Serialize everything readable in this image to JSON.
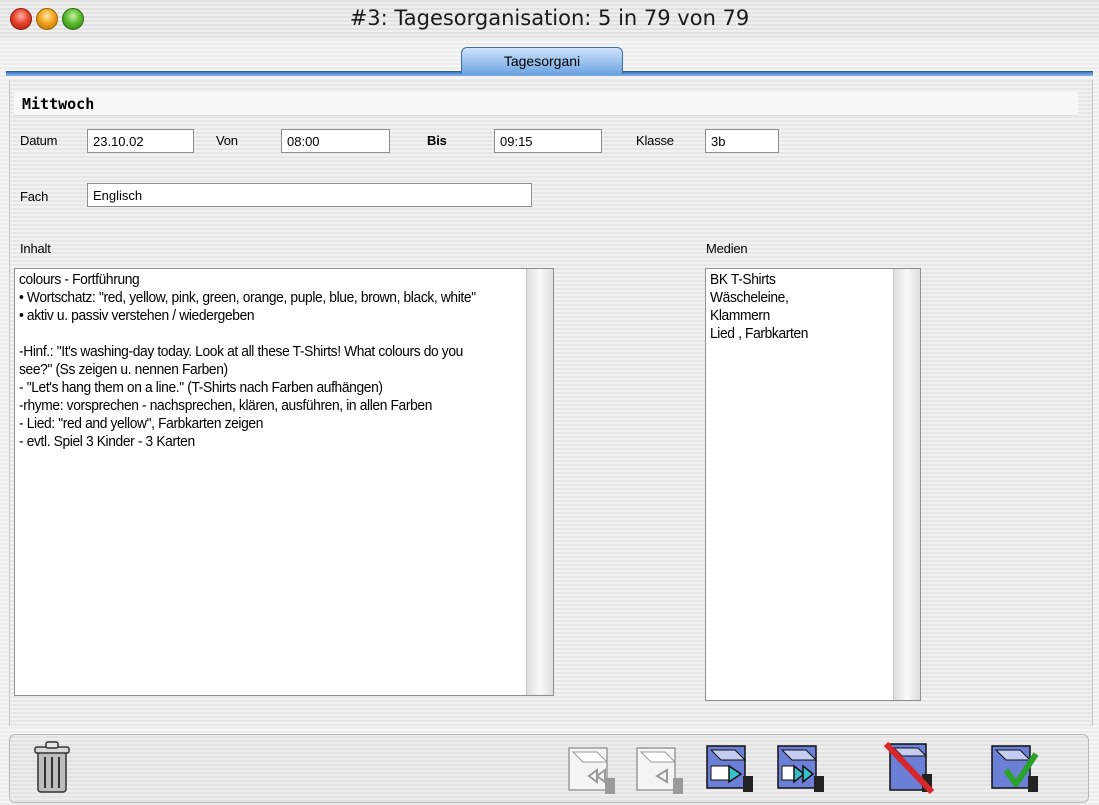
{
  "window": {
    "title": "#3: Tagesorganisation: 5 in 79 von 79",
    "tab_label": "Tagesorgani"
  },
  "record": {
    "day": "Mittwoch",
    "datum_label": "Datum",
    "datum_value": "23.10.02",
    "von_label": "Von",
    "von_value": "08:00",
    "bis_label": "Bis",
    "bis_value": "09:15",
    "klasse_label": "Klasse",
    "klasse_value": "3b",
    "fach_label": "Fach",
    "fach_value": "Englisch",
    "inhalt_label": "Inhalt",
    "inhalt_text": "colours - Fortführung\n• Wortschatz: \"red, yellow, pink, green, orange, puple, blue, brown, black, white\"\n• aktiv u. passiv verstehen / wiedergeben\n\n-Hinf.: \"It's washing-day today. Look at all these T-Shirts! What colours do you see?\" (Ss zeigen u. nennen Farben)\n- \"Let's hang them on a line.\" (T-Shirts nach Farben aufhängen)\n-rhyme: vorsprechen - nachsprechen, klären, ausführen, in allen Farben\n- Lied: \"red and yellow\", Farbkarten zeigen\n- evtl. Spiel 3 Kinder - 3 Karten",
    "medien_label": "Medien",
    "medien_text": "BK T-Shirts\nWäscheleine,\nKlammern\nLied , Farbkarten"
  },
  "toolbar": {
    "buttons": [
      {
        "icon": "trash-icon"
      },
      {
        "icon": "first-record-icon"
      },
      {
        "icon": "previous-record-icon"
      },
      {
        "icon": "next-record-icon"
      },
      {
        "icon": "last-record-icon"
      },
      {
        "icon": "cancel-icon"
      },
      {
        "icon": "accept-icon"
      }
    ],
    "accent_red": "#d8262a",
    "accent_green": "#2aa12a",
    "folder_blue": "#6b7fd6"
  }
}
